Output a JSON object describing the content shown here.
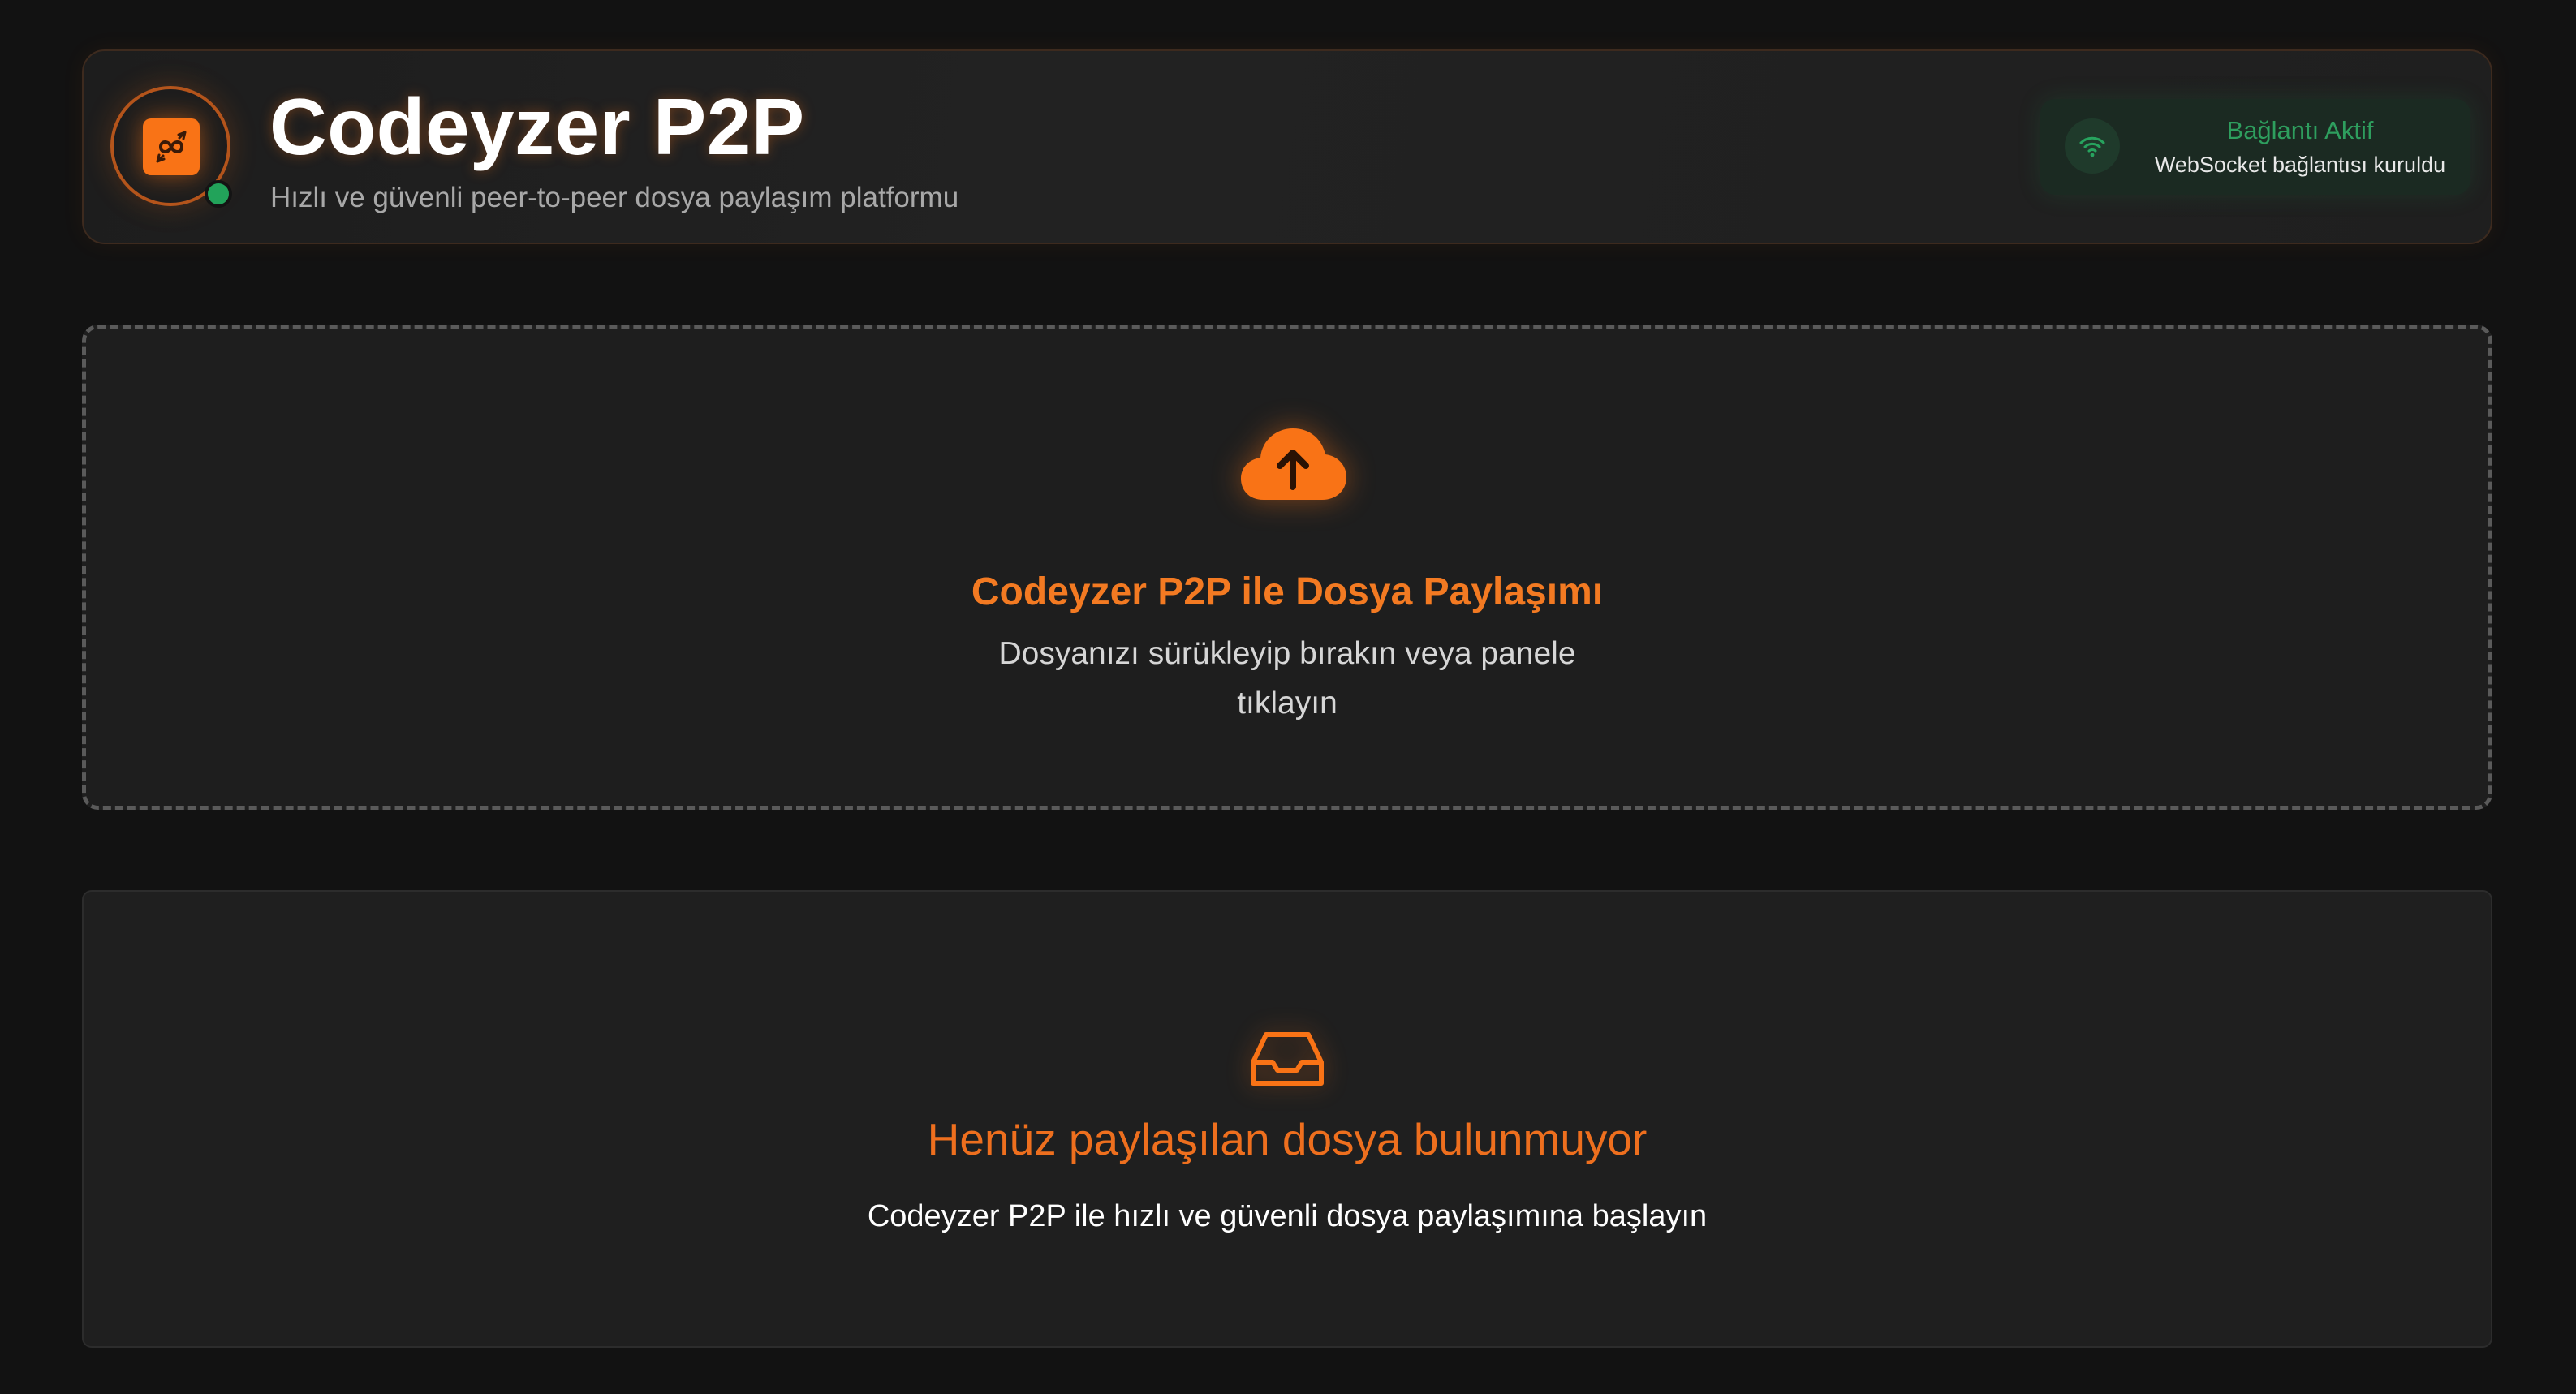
{
  "header": {
    "title": "Codeyzer P2P",
    "subtitle": "Hızlı ve güvenli peer-to-peer dosya paylaşım platformu",
    "logo_icon": "infinity-arrows-icon"
  },
  "connection": {
    "title": "Bağlantı Aktif",
    "detail": "WebSocket bağlantısı kuruldu",
    "icon": "wifi-icon",
    "online": true
  },
  "upload": {
    "icon": "cloud-upload-icon",
    "title": "Codeyzer P2P ile Dosya Paylaşımı",
    "description": "Dosyanızı sürükleyip bırakın veya panele tıklayın"
  },
  "shared_files": {
    "icon": "inbox-icon",
    "empty_title": "Henüz paylaşılan dosya bulunmuyor",
    "empty_description": "Codeyzer P2P ile hızlı ve güvenli dosya paylaşımına başlayın",
    "items": []
  },
  "colors": {
    "background": "#121212",
    "accent": "#f97316",
    "accent_text": "#f37a22",
    "success": "#22a35a",
    "panel": "#1f1f1f"
  }
}
